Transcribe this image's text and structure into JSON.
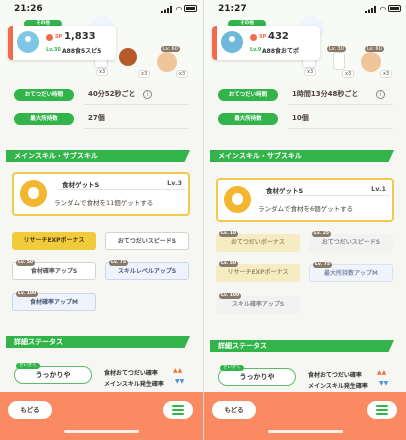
{
  "left": {
    "status_time": "21:26",
    "sp_label": "SP",
    "sp_value": "1,833",
    "top_tag": "その他",
    "level": "Lv.30",
    "nickname": "A88食5スピ5",
    "food_counts": [
      "x3",
      "x3",
      "x3"
    ],
    "food_lv": "Lv. 60",
    "rows": [
      {
        "label": "おてつだい時間",
        "value": "40分52秒ごと"
      },
      {
        "label": "最大所持数",
        "value": "27個"
      }
    ],
    "section_skills": "メインスキル・サブスキル",
    "skill": {
      "name": "食材ゲットS",
      "level": "Lv.3",
      "description": "ランダムで食材を11個ゲットする"
    },
    "subskills": [
      {
        "label": "リサーチEXPボーナス",
        "lv": "",
        "style": "gold"
      },
      {
        "label": "おてつだいスピードS",
        "lv": "",
        "style": "white"
      },
      {
        "label": "食材確率アップS",
        "lv": "Lv. 50",
        "style": "white"
      },
      {
        "label": "スキルレベルアップS",
        "lv": "Lv. 75",
        "style": "blue"
      },
      {
        "label": "食材確率アップM",
        "lv": "Lv. 100",
        "style": "blue"
      }
    ],
    "section_details": "詳細ステータス",
    "nature_tag": "せいかく",
    "nature": "うっかりや",
    "stat_up": "食材おてつだい確率",
    "stat_down": "メインスキル発生確率",
    "back_label": "もどる"
  },
  "right": {
    "status_time": "21:27",
    "sp_label": "SP",
    "sp_value": "432",
    "top_tag": "その他",
    "level": "Lv.9",
    "nickname": "A88食おてポ",
    "food_counts": [
      "x3",
      "x3",
      "x3"
    ],
    "food_lvs": [
      "Lv. 30",
      "Lv. 60"
    ],
    "rows": [
      {
        "label": "おてつだい時間",
        "value": "1時間13分48秒ごと"
      },
      {
        "label": "最大所持数",
        "value": "10個"
      }
    ],
    "section_skills": "メインスキル・サブスキル",
    "skill": {
      "name": "食材ゲットS",
      "level": "Lv.1",
      "description": "ランダムで食材を6個ゲットする"
    },
    "subskills": [
      {
        "label": "おてつだいボーナス",
        "lv": "Lv. 10",
        "style": "palegold"
      },
      {
        "label": "おてつだいスピードS",
        "lv": "Lv. 25",
        "style": "grey"
      },
      {
        "label": "リサーチEXPボーナス",
        "lv": "Lv. 50",
        "style": "palegold"
      },
      {
        "label": "最大所持数アップM",
        "lv": "Lv. 75",
        "style": "paleblue"
      },
      {
        "label": "スキル確率アップS",
        "lv": "Lv. 100",
        "style": "grey"
      }
    ],
    "section_details": "詳細ステータス",
    "nature_tag": "せいかく",
    "nature": "うっかりや",
    "stat_up": "食材おてつだい確率",
    "stat_down": "メインスキル発生確率",
    "back_label": "もどる"
  },
  "icons": {
    "sp": "sp-icon",
    "info": "info-icon",
    "menu": "menu-icon",
    "skill": "apple-icon"
  },
  "colors": {
    "accent_green": "#32b44a",
    "bottom_bar": "#f98a62",
    "skill_border": "#f2c94c",
    "arrow_up": "#f0703a",
    "arrow_down": "#4b8fe0"
  }
}
